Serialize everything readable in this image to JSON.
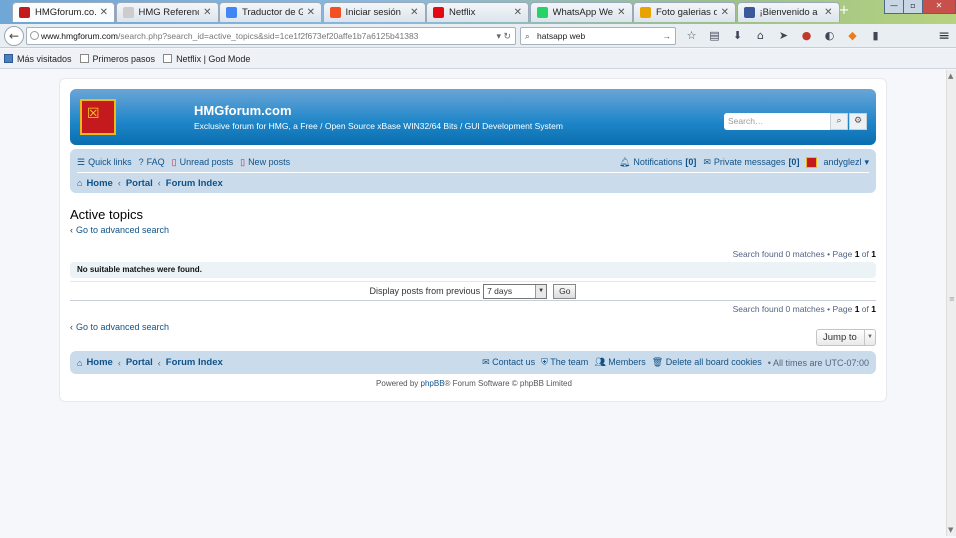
{
  "browser": {
    "tabs": [
      {
        "title": "HMGforum.co...",
        "active": true,
        "fav_color": "#c4191d"
      },
      {
        "title": "HMG Reference (c)...",
        "active": false,
        "fav_color": "#cccccc"
      },
      {
        "title": "Traductor de G...",
        "active": false,
        "fav_color": "#4285f4"
      },
      {
        "title": "Iniciar sesión",
        "active": false,
        "fav_color": "#f25022"
      },
      {
        "title": "Netflix",
        "active": false,
        "fav_color": "#e50914"
      },
      {
        "title": "WhatsApp Web",
        "active": false,
        "fav_color": "#25d366"
      },
      {
        "title": "Foto galerias d...",
        "active": false,
        "fav_color": "#e8a300"
      },
      {
        "title": "¡Bienvenido a ...",
        "active": false,
        "fav_color": "#3b5998"
      }
    ],
    "url_host": "www.hmgforum.com",
    "url_path": "/search.php?search_id=active_topics&sid=1ce1f2f673ef20affe1b7a6125b41383",
    "search_value": "hatsapp web",
    "bookmarks": [
      "Más visitados",
      "Primeros pasos",
      "Netflix | God Mode"
    ]
  },
  "forum": {
    "title": "HMGforum.com",
    "description": "Exclusive forum for HMG, a Free / Open Source xBase WIN32/64 Bits / GUI Development System",
    "search_placeholder": "Search…",
    "quick_links": "Quick links",
    "faq": "FAQ",
    "unread_posts": "Unread posts",
    "new_posts": "New posts",
    "notifications": "Notifications",
    "notifications_count": "[0]",
    "private_messages": "Private messages",
    "private_messages_count": "[0]",
    "username": "andyglezl",
    "breadcrumbs": [
      "Home",
      "Portal",
      "Forum Index"
    ]
  },
  "content": {
    "page_title": "Active topics",
    "advanced_search": "Go to advanced search",
    "search_found_prefix": "Search found 0 matches • Page",
    "page_current": "1",
    "page_of": "of",
    "page_total": "1",
    "no_matches": "No suitable matches were found.",
    "display_label": "Display posts from previous",
    "display_value": "7 days",
    "go_label": "Go",
    "jump_to": "Jump to"
  },
  "footer": {
    "contact": "Contact us",
    "team": "The team",
    "members": "Members",
    "delete_cookies": "Delete all board cookies",
    "timezone_prefix": "All times are",
    "timezone": "UTC-07:00",
    "powered_prefix": "Powered by",
    "powered_link": "phpBB",
    "powered_suffix": "® Forum Software © phpBB Limited"
  }
}
